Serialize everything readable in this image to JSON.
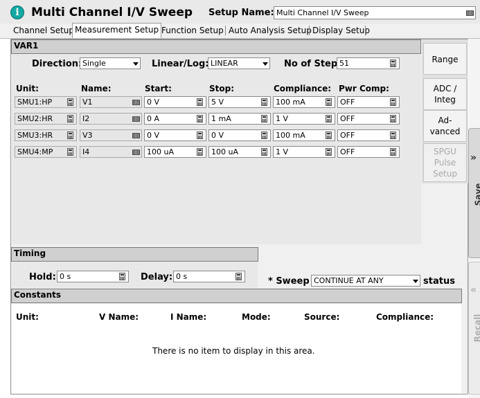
{
  "window": {
    "title": "Multi Channel I/V Sweep",
    "setup_name_label": "Setup Name:",
    "setup_name_value": "Multi Channel I/V Sweep"
  },
  "tabs": [
    {
      "label": "Channel Setup",
      "active": false
    },
    {
      "label": "Measurement Setup",
      "active": true
    },
    {
      "label": "Function Setup",
      "active": false
    },
    {
      "label": "Auto Analysis Setup",
      "active": false
    },
    {
      "label": "Display Setup",
      "active": false
    }
  ],
  "var1": {
    "title": "VAR1",
    "direction_label": "Direction:",
    "direction_value": "Single",
    "linlog_label": "Linear/Log:",
    "linlog_value": "LINEAR",
    "steps_label": "No of Step:",
    "steps_value": "51",
    "columns": [
      "Unit:",
      "Name:",
      "Start:",
      "Stop:",
      "Compliance:",
      "Pwr Comp:"
    ],
    "rows": [
      {
        "unit": "SMU1:HP",
        "name": "V1",
        "start": "0 V",
        "stop": "5 V",
        "compliance": "100 mA",
        "pwr": "OFF"
      },
      {
        "unit": "SMU2:HR",
        "name": "I2",
        "start": "0 A",
        "stop": "1 mA",
        "compliance": "1 V",
        "pwr": "OFF"
      },
      {
        "unit": "SMU3:HR",
        "name": "V3",
        "start": "0 V",
        "stop": "0 V",
        "compliance": "100 mA",
        "pwr": "OFF"
      },
      {
        "unit": "SMU4:MP",
        "name": "I4",
        "start": "100 uA",
        "stop": "100 uA",
        "compliance": "1 V",
        "pwr": "OFF"
      }
    ]
  },
  "side_buttons": {
    "range": "Range",
    "adc_l1": "ADC /",
    "adc_l2": "Integ",
    "adv_l1": "Ad-",
    "adv_l2": "vanced",
    "spgu_l1": "SPGU",
    "spgu_l2": "Pulse",
    "spgu_l3": "Setup"
  },
  "timing": {
    "title": "Timing",
    "hold_label": "Hold:",
    "hold_value": "0 s",
    "delay_label": "Delay:",
    "delay_value": "0 s",
    "sweep_prefix": "* Sweep",
    "sweep_value": "CONTINUE AT ANY",
    "sweep_suffix": "status"
  },
  "constants": {
    "title": "Constants",
    "columns": [
      "Unit:",
      "V Name:",
      "I Name:",
      "Mode:",
      "Source:",
      "Compliance:"
    ],
    "empty_message": "There is no item to display in this area."
  },
  "right_panel": {
    "save_label": "Save",
    "recall_label": "Recall"
  }
}
